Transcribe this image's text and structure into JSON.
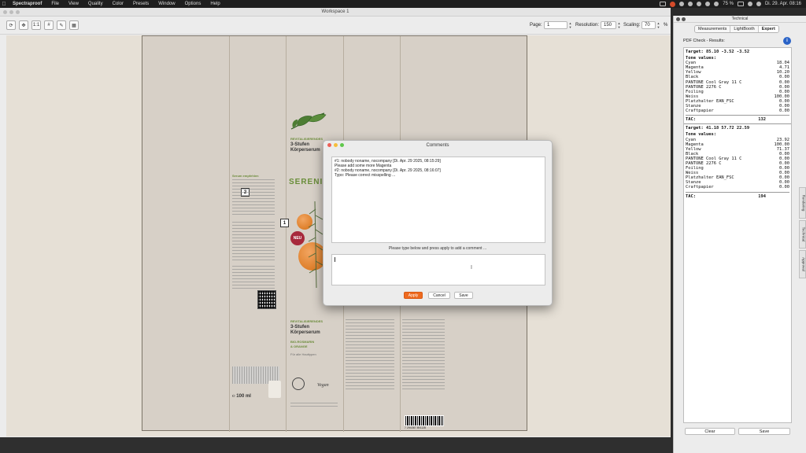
{
  "menubar": {
    "app": "Spectraproof",
    "items": [
      "File",
      "View",
      "Quality",
      "Color",
      "Presets",
      "Window",
      "Options",
      "Help"
    ],
    "battery": "75 %",
    "clock": "Di. 29. Apr. 08:16"
  },
  "window": {
    "title": "Workspace 1"
  },
  "toolbar": {
    "zoom_1to1": "1:1",
    "grid": "#",
    "page_label": "Page:",
    "page_value": "1",
    "resolution_label": "Resolution:",
    "resolution_value": "150",
    "scaling_label": "Scaling:",
    "scaling_value": "70",
    "scaling_unit": "%"
  },
  "artwork": {
    "brand_line1": "REVITALISIERENDES",
    "brand_line2": "3-Stufen",
    "brand_line3": "Körperserum",
    "brand_name": "SERENIQU",
    "badge": "NEU",
    "marker_1": "1",
    "marker_2": "2",
    "side_heading": "Serum empfehlen",
    "lower_line1": "REVITALISIERENDES",
    "lower_line2": "3-Stufen",
    "lower_line3": "Körperserum",
    "lower_line4": "BIO-ROSMARIN",
    "lower_line5": "& ORANGE",
    "lower_line6": "Für alle Hauttypen",
    "volume": "℮ 100 ml",
    "vegan": "Vegan",
    "barcode": "7 294367 891128"
  },
  "dialog": {
    "title": "Comments",
    "comments": [
      "#1: nobody noname, nocompany [Di. Apr. 29 2025, 08:15:29]",
      "Please add some more Magenta",
      "#2: nobody noname, nocompany [Di. Apr. 29 2025, 08:16:07]",
      "Typo: Please correct misspelling ..."
    ],
    "hint": "Please type below and press apply to add a comment ...",
    "apply": "Apply",
    "cancel": "Cancel",
    "save": "Save"
  },
  "panel": {
    "title": "Technical",
    "tabs": [
      "Measurements",
      "LightBooth",
      "Expert"
    ],
    "results_label": "PDF Check - Results:",
    "info": "i",
    "sections": [
      {
        "target": "Target: 85.10 -3.52 -3.52",
        "tone_header": "Tone values:",
        "rows": [
          {
            "name": "Cyan",
            "value": "18.04"
          },
          {
            "name": "Magenta",
            "value": "4.71"
          },
          {
            "name": "Yellow",
            "value": "10.20"
          },
          {
            "name": "Black",
            "value": "0.00"
          },
          {
            "name": "PANTONE Cool Gray 11 C",
            "value": "0.00"
          },
          {
            "name": "PANTONE 2276 C",
            "value": "0.00"
          },
          {
            "name": "Foiling",
            "value": "0.00"
          },
          {
            "name": "Weiss",
            "value": "100.00"
          },
          {
            "name": "Platzhalter EAN_FSC",
            "value": "0.00"
          },
          {
            "name": "Stanze",
            "value": "0.00"
          },
          {
            "name": "Craftpapier",
            "value": "0.00"
          }
        ],
        "tac_label": "TAC:",
        "tac_value": "132"
      },
      {
        "target": "Target: 41.18 57.72 22.59",
        "tone_header": "Tone values:",
        "rows": [
          {
            "name": "Cyan",
            "value": "23.92"
          },
          {
            "name": "Magenta",
            "value": "100.00"
          },
          {
            "name": "Yellow",
            "value": "71.37"
          },
          {
            "name": "Black",
            "value": "0.00"
          },
          {
            "name": "PANTONE Cool Gray 11 C",
            "value": "0.00"
          },
          {
            "name": "PANTONE 2276 C",
            "value": "0.00"
          },
          {
            "name": "Foiling",
            "value": "0.00"
          },
          {
            "name": "Weiss",
            "value": "0.00"
          },
          {
            "name": "Platzhalter EAN_FSC",
            "value": "0.00"
          },
          {
            "name": "Stanze",
            "value": "0.00"
          },
          {
            "name": "Craftpapier",
            "value": "0.00"
          }
        ],
        "tac_label": "TAC:",
        "tac_value": "194"
      }
    ],
    "clear": "Clear",
    "save": "Save",
    "side_tabs": [
      "Rendering",
      "Technical",
      "Approval"
    ]
  }
}
